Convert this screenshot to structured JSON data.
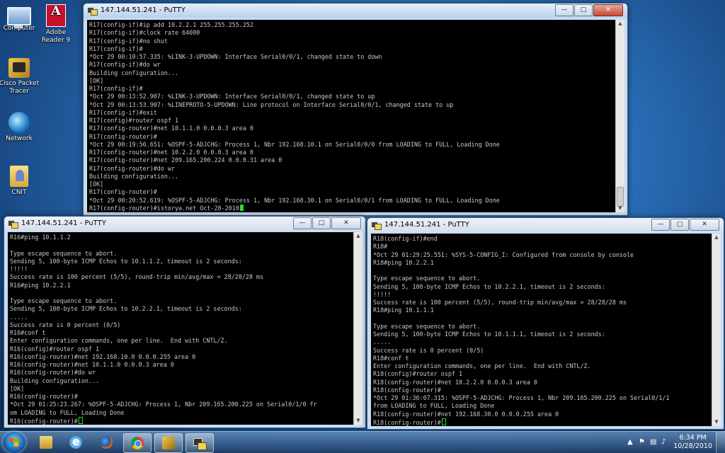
{
  "desktop": {
    "icons": [
      {
        "label": "Computer"
      },
      {
        "label": "Adobe\nReader 9"
      },
      {
        "label": "Cisco Packet\nTracer"
      },
      {
        "label": "Network"
      },
      {
        "label": "CNIT"
      }
    ]
  },
  "windows": [
    {
      "title": "147.144.51.241 - PuTTY",
      "lines": [
        "R17(config-if)#ip add 10.2.2.1 255.255.255.252",
        "R17(config-if)#clock rate 64000",
        "R17(config-if)#no shut",
        "R17(config-if)#",
        "*Oct 29 00:10:57.335: %LINK-3-UPDOWN: Interface Serial0/0/1, changed state to down",
        "R17(config-if)#do wr",
        "Building configuration...",
        "[OK]",
        "R17(config-if)#",
        "*Oct 29 00:13:52.907: %LINK-3-UPDOWN: Interface Serial0/0/1, changed state to up",
        "*Oct 29 00:13:53.907: %LINEPROTO-5-UPDOWN: Line protocol on Interface Serial0/0/1, changed state to up",
        "R17(config-if)#exit",
        "R17(config)#router ospf 1",
        "R17(config-router)#net 10.1.1.0 0.0.0.3 area 0",
        "R17(config-router)#",
        "*Oct 29 00:19:56.651: %OSPF-5-ADJCHG: Process 1, Nbr 192.168.10.1 on Serial0/0/0 from LOADING to FULL, Loading Done",
        "R17(config-router)#net 10.2.2.0 0.0.0.3 area 0",
        "R17(config-router)#net 209.165.200.224 0.0.0.31 area 0",
        "R17(config-router)#do wr",
        "Building configuration...",
        "[OK]",
        "R17(config-router)#",
        "*Oct 29 00:20:52.619: %OSPF-5-ADJCHG: Process 1, Nbr 192.168.30.1 on Serial0/0/1 from LOADING to FULL, Loading Done",
        "R17(config-router)#istorya.net Oct-28-2010"
      ]
    },
    {
      "title": "147.144.51.241 - PuTTY",
      "lines": [
        "R16#ping 10.1.1.2",
        "",
        "Type escape sequence to abort.",
        "Sending 5, 100-byte ICMP Echos to 10.1.1.2, timeout is 2 seconds:",
        "!!!!!",
        "Success rate is 100 percent (5/5), round-trip min/avg/max = 28/28/28 ms",
        "R16#ping 10.2.2.1",
        "",
        "Type escape sequence to abort.",
        "Sending 5, 100-byte ICMP Echos to 10.2.2.1, timeout is 2 seconds:",
        ".....",
        "Success rate is 0 percent (0/5)",
        "R16#conf t",
        "Enter configuration commands, one per line.  End with CNTL/Z.",
        "R16(config)#router ospf 1",
        "R16(config-router)#net 192.168.10.0 0.0.0.255 area 0",
        "R16(config-router)#net 10.1.1.0 0.0.0.3 area 0",
        "R16(config-router)#do wr",
        "Building configuration...",
        "[OK]",
        "R16(config-router)#",
        "*Oct 29 01:25:23.267: %OSPF-5-ADJCHG: Process 1, Nbr 209.165.200.225 on Serial0/1/0 fr",
        "om LOADING to FULL, Loading Done",
        "R16(config-router)#"
      ]
    },
    {
      "title": "147.144.51.241 - PuTTY",
      "lines": [
        "R18(config-if)#end",
        "R18#",
        "*Oct 29 01:29:25.551: %SYS-5-CONFIG_I: Configured from console by console",
        "R18#ping 10.2.2.1",
        "",
        "Type escape sequence to abort.",
        "Sending 5, 100-byte ICMP Echos to 10.2.2.1, timeout is 2 seconds:",
        "!!!!!",
        "Success rate is 100 percent (5/5), round-trip min/avg/max = 28/28/28 ms",
        "R18#ping 10.1.1.1",
        "",
        "Type escape sequence to abort.",
        "Sending 5, 100-byte ICMP Echos to 10.1.1.1, timeout is 2 seconds:",
        ".....",
        "Success rate is 0 percent (0/5)",
        "R18#conf t",
        "Enter configuration commands, one per line.  End with CNTL/Z.",
        "R18(config)#router ospf 1",
        "R18(config-router)#net 10.2.2.0 0.0.0.3 area 0",
        "R18(config-router)#",
        "*Oct 29 01:36:07.315: %OSPF-5-ADJCHG: Process 1, Nbr 209.165.200.225 on Serial0/1/1",
        "from LOADING to FULL, Loading Done",
        "R18(config-router)#net 192.168.30.0 0.0.0.255 area 0",
        "R18(config-router)#"
      ]
    }
  ],
  "taskbar": {
    "clock_time": "6:34 PM",
    "clock_date": "10/28/2010"
  }
}
